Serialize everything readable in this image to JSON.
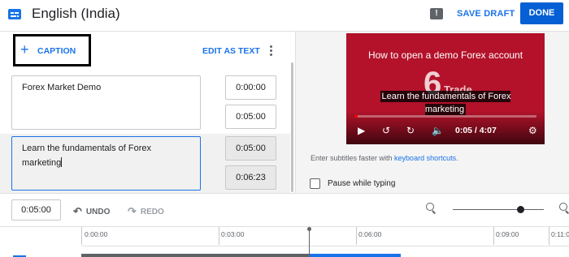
{
  "header": {
    "title": "English (India)",
    "save_draft": "SAVE DRAFT",
    "done": "DONE",
    "feedback_icon_glyph": "!",
    "title_icon": "subtitles-icon"
  },
  "editor": {
    "caption_button": "CAPTION",
    "edit_as_text": "EDIT AS TEXT",
    "cues": [
      {
        "text": "Forex Market Demo",
        "start": "0:00:00",
        "end": "0:05:00"
      },
      {
        "text": "Learn the fundamentals of Forex marketing",
        "start": "0:05:00",
        "end": "0:06:23"
      }
    ]
  },
  "preview": {
    "video_title": "How to open a demo Forex account",
    "brand_text": "6",
    "brand_text2": "Trade",
    "subtitle": "Learn the fundamentals of Forex marketing",
    "time": "0:05 / 4:07",
    "progress": 0.02,
    "shortcut_tip_prefix": "Enter subtitles faster with ",
    "shortcut_tip_link": "keyboard shortcuts",
    "shortcut_tip_suffix": ".",
    "pause_label": "Pause while typing"
  },
  "toolbar": {
    "current_time": "0:05:00",
    "undo": "UNDO",
    "redo": "REDO",
    "zoom_level": 0.7
  },
  "timeline": {
    "ticks": [
      "0:00:00",
      "0:03:00",
      "0:06:00",
      "0:09:00",
      "0:11:0"
    ]
  },
  "colors": {
    "accent": "#1a73e8",
    "done_bg": "#065fd4",
    "video_bg": "#b3122a"
  }
}
